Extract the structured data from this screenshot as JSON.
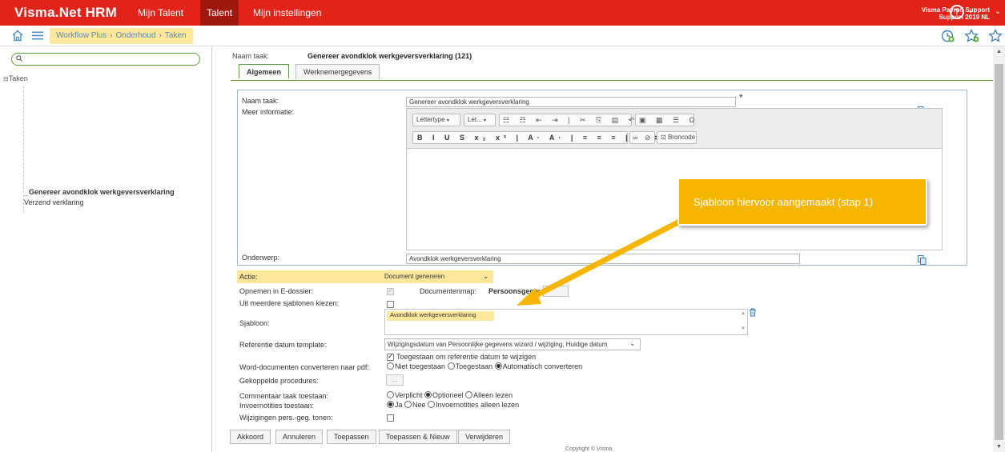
{
  "topbar": {
    "brand": "Visma.Net HRM",
    "nav": [
      "Mijn Talent",
      "Talent",
      "Mijn instellingen"
    ],
    "active_nav": "Talent",
    "help_label": "?",
    "user_line1": "Visma Payroll Support",
    "user_line2": "Support 2019 NL"
  },
  "breadcrumb": [
    "Workflow Plus",
    "Onderhoud",
    "Taken"
  ],
  "sidebar": {
    "search_placeholder": "",
    "tree_root": "Taken",
    "items": [
      "Genereer avondklok werkgeversverklaring",
      "Verzend verklaring"
    ]
  },
  "header": {
    "task_label": "Naam taak:",
    "task_name": "Genereer avondklok werkgeversverklaring (121)"
  },
  "tabs": [
    "Algemeen",
    "Werknemergegevens"
  ],
  "form": {
    "naam_taak_label": "Naam taak:",
    "naam_taak_value": "Genereer avondklok werkgeversverklaring",
    "required_mark": "*",
    "meer_informatie_label": "Meer informatie:",
    "editor": {
      "font_dropdown": "Lettertype",
      "size_dropdown": "Let...",
      "source_button": "Broncode"
    },
    "onderwerp_label": "Onderwerp:",
    "onderwerp_value": "Avondklok werkgeversverklaring",
    "actie_label": "Actie:",
    "actie_value": "Document genereren",
    "opnemen_label": "Opnemen in E-dossier:",
    "documentenmap_label": "Documentenmap:",
    "documentenmap_value": "Persoonsgegevens",
    "meerdere_label": "Uit meerdere sjablonen kiezen:",
    "sjabloon_label": "Sjabloon:",
    "sjabloon_value": "Avondklok werkgeversverklaring",
    "referentie_label": "Referentie datum template:",
    "referentie_value": "Wijzigingsdatum van Persoonlijke gegevens wizard / wijziging, Huidige datum",
    "toegestaan_wijzigen": "Toegestaan om referentie datum te wijzigen",
    "word_label": "Word-documenten converteren naar pdf:",
    "word_options": [
      "Niet toegestaan",
      "Toegestaan",
      "Automatisch converteren"
    ],
    "gekoppelde_label": "Gekoppelde procedures:",
    "gekoppelde_button": "...",
    "commentaar_label": "Commentaar taak toestaan:",
    "commentaar_options": [
      "Verplicht",
      "Optioneel",
      "Alleen lezen"
    ],
    "invoer_label": "Invoernotities toestaan:",
    "invoer_options": [
      "Ja",
      "Nee",
      "Invoernotities alleen lezen"
    ],
    "wijzigingen_label": "Wijzigingen pers.-geg. tonen:"
  },
  "buttons": [
    "Akkoord",
    "Annuleren",
    "Toepassen",
    "Toepassen & Nieuw",
    "Verwijderen"
  ],
  "copyright": "Copyright © Visma",
  "callout": "Sjabloon hiervoor aangemaakt (stap 1)",
  "colors": {
    "brand_red": "#e2231a",
    "active_nav": "#9e1810",
    "highlight": "#fde79b",
    "callout": "#f6b600",
    "green_accent": "#5f9e3e"
  }
}
